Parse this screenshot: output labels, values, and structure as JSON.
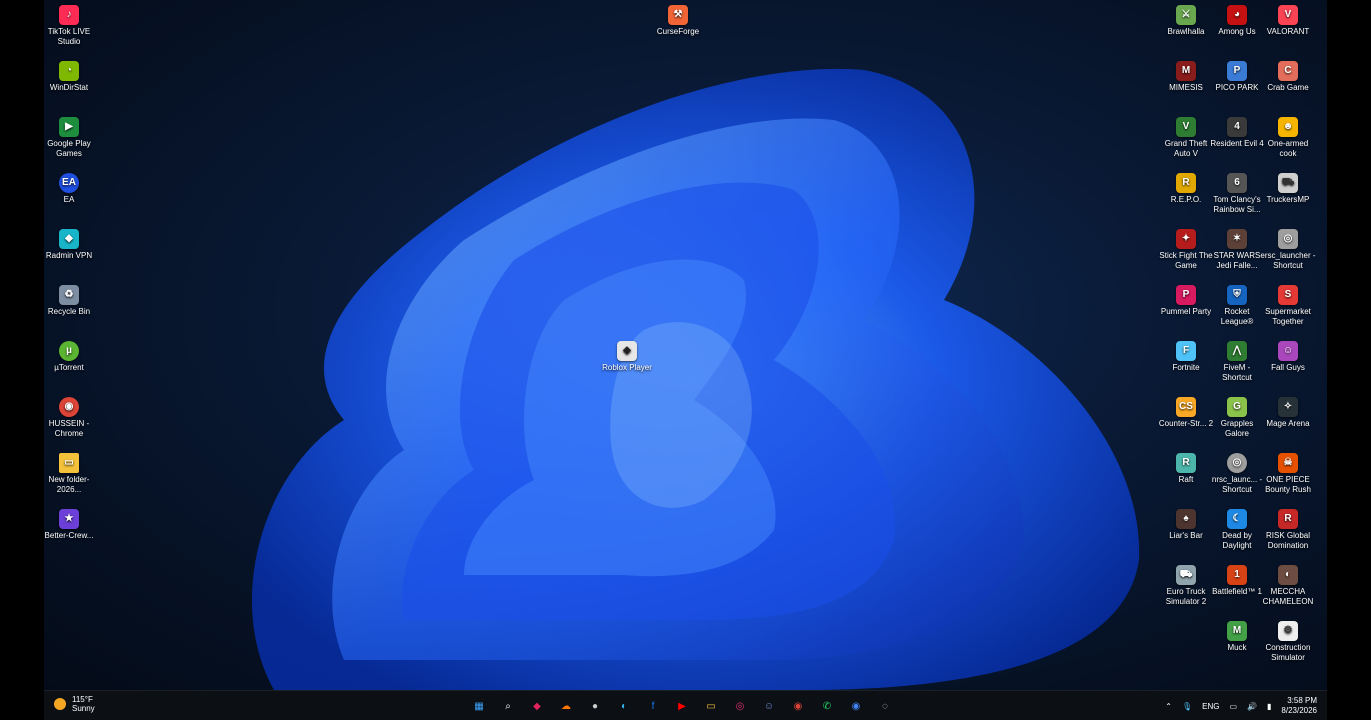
{
  "icons": {
    "tiktok": {
      "label": "TikTok LIVE Studio",
      "color": "#fe2c55",
      "icon": "tiktok-icon"
    },
    "windirstat": {
      "label": "WinDirStat",
      "color": "#7fb800",
      "icon": "windirstat-icon"
    },
    "googleplay": {
      "label": "Google Play Games",
      "color": "#1e8e3e",
      "icon": "google-play-icon"
    },
    "ea": {
      "label": "EA",
      "color": "#1f4fe0",
      "icon": "ea-icon"
    },
    "radmin": {
      "label": "Radmin VPN",
      "color": "#18b5c9",
      "icon": "radmin-icon"
    },
    "recycle": {
      "label": "Recycle Bin",
      "color": "#7d8ea3",
      "icon": "recycle-bin-icon"
    },
    "utorrent": {
      "label": "µTorrent",
      "color": "#5cb532",
      "icon": "utorrent-icon"
    },
    "hussein": {
      "label": "HUSSEIN - Chrome",
      "color": "#db4437",
      "icon": "chrome-icon"
    },
    "newfolder": {
      "label": "New folder-2026...",
      "color": "#f3c13a",
      "icon": "folder-icon"
    },
    "bettercrew": {
      "label": "Better-Crew...",
      "color": "#6b3fd8",
      "icon": "better-crew-icon"
    },
    "curseforge": {
      "label": "CurseForge",
      "color": "#f16436",
      "icon": "curseforge-icon"
    },
    "roblox": {
      "label": "Roblox Player",
      "color": "#e6e6e6",
      "icon": "roblox-icon"
    },
    "r1": [
      {
        "label": "Brawlhalla",
        "color": "#6aa84f",
        "icon": "brawlhalla-icon"
      },
      {
        "label": "Among Us",
        "color": "#c51111",
        "icon": "among-us-icon"
      },
      {
        "label": "VALORANT",
        "color": "#fa4454",
        "icon": "valorant-icon"
      }
    ],
    "r2": [
      {
        "label": "MIMESIS",
        "color": "#8a1c1c",
        "icon": "mimesis-icon"
      },
      {
        "label": "PICO PARK",
        "color": "#3a7bd5",
        "icon": "pico-park-icon"
      },
      {
        "label": "Crab Game",
        "color": "#e26d5a",
        "icon": "crab-game-icon"
      }
    ],
    "r3": [
      {
        "label": "Grand Theft Auto V",
        "color": "#2e7d32",
        "icon": "gta-icon"
      },
      {
        "label": "Resident Evil 4",
        "color": "#3a3a3a",
        "icon": "resident-evil-icon"
      },
      {
        "label": "One-armed cook",
        "color": "#f4b400",
        "icon": "cook-icon"
      }
    ],
    "r4": [
      {
        "label": "R.E.P.O.",
        "color": "#e0a800",
        "icon": "repo-icon"
      },
      {
        "label": "Tom Clancy's Rainbow Si...",
        "color": "#555555",
        "icon": "rainbow-six-icon"
      },
      {
        "label": "TruckersMP",
        "color": "#cfcfcf",
        "icon": "truckersmp-icon"
      }
    ],
    "r5": [
      {
        "label": "Stick Fight The Game",
        "color": "#b71c1c",
        "icon": "stick-fight-icon"
      },
      {
        "label": "STAR WARS Jedi Falle...",
        "color": "#5d4037",
        "icon": "star-wars-icon"
      },
      {
        "label": "ersc_launcher - Shortcut",
        "color": "#9e9e9e",
        "icon": "ersc-launcher-icon"
      }
    ],
    "r6": [
      {
        "label": "Pummel Party",
        "color": "#d81b60",
        "icon": "pummel-party-icon"
      },
      {
        "label": "Rocket League®",
        "color": "#1565c0",
        "icon": "rocket-league-icon"
      },
      {
        "label": "Supermarket Together",
        "color": "#e53935",
        "icon": "supermarket-icon"
      }
    ],
    "r7": [
      {
        "label": "Fortnite",
        "color": "#4fc3f7",
        "icon": "fortnite-icon"
      },
      {
        "label": "FiveM - Shortcut",
        "color": "#2e7d32",
        "icon": "fivem-icon"
      },
      {
        "label": "Fall Guys",
        "color": "#ab47bc",
        "icon": "fall-guys-icon"
      }
    ],
    "r8": [
      {
        "label": "Counter-Str... 2",
        "color": "#f9a825",
        "icon": "counter-strike-icon"
      },
      {
        "label": "Grapples Galore",
        "color": "#8bc34a",
        "icon": "grapples-icon"
      },
      {
        "label": "Mage Arena",
        "color": "#263238",
        "icon": "mage-arena-icon"
      }
    ],
    "r9": [
      {
        "label": "Raft",
        "color": "#4db6ac",
        "icon": "raft-icon"
      },
      {
        "label": "nrsc_launc... - Shortcut",
        "color": "#9e9e9e",
        "icon": "nrsc-launcher-icon"
      },
      {
        "label": "ONE PIECE Bounty Rush",
        "color": "#e65100",
        "icon": "one-piece-icon"
      }
    ],
    "r10": [
      {
        "label": "Liar's Bar",
        "color": "#4e342e",
        "icon": "liars-bar-icon"
      },
      {
        "label": "Dead by Daylight",
        "color": "#1e88e5",
        "icon": "dead-by-daylight-icon"
      },
      {
        "label": "RISK Global Domination",
        "color": "#c62828",
        "icon": "risk-icon"
      }
    ],
    "r11": [
      {
        "label": "Euro Truck Simulator 2",
        "color": "#90a4ae",
        "icon": "euro-truck-icon"
      },
      {
        "label": "Battlefield™ 1",
        "color": "#d84315",
        "icon": "battlefield-icon"
      },
      {
        "label": "MECCHA CHAMELEON",
        "color": "#6d4c41",
        "icon": "chameleon-icon"
      }
    ],
    "r12": [
      {
        "label": "Muck",
        "color": "#43a047",
        "icon": "muck-icon"
      },
      {
        "label": "Construction Simulator",
        "color": "#eeeeee",
        "icon": "construction-icon"
      }
    ]
  },
  "taskbar": {
    "weather_temp": "115°F",
    "weather_desc": "Sunny",
    "apps": [
      {
        "name": "start-icon",
        "glyph": "▦",
        "color": "#3ea6ff"
      },
      {
        "name": "search-icon",
        "glyph": "⌕",
        "color": "#ffffff"
      },
      {
        "name": "roblox-taskbar-icon",
        "glyph": "◆",
        "color": "#e0245e"
      },
      {
        "name": "soundcloud-icon",
        "glyph": "☁",
        "color": "#ff7700"
      },
      {
        "name": "github-icon",
        "glyph": "●",
        "color": "#cccccc"
      },
      {
        "name": "edge-icon",
        "glyph": "◐",
        "color": "#2fb2e8"
      },
      {
        "name": "facebook-icon",
        "glyph": "f",
        "color": "#1877f2"
      },
      {
        "name": "youtube-icon",
        "glyph": "▶",
        "color": "#ff0000"
      },
      {
        "name": "file-explorer-icon",
        "glyph": "▭",
        "color": "#f3c13a"
      },
      {
        "name": "instagram-icon",
        "glyph": "◎",
        "color": "#e1306c"
      },
      {
        "name": "discord-icon",
        "glyph": "☺",
        "color": "#7289da"
      },
      {
        "name": "chrome-taskbar-icon",
        "glyph": "◉",
        "color": "#db4437"
      },
      {
        "name": "whatsapp-icon",
        "glyph": "✆",
        "color": "#25d366"
      },
      {
        "name": "chrome-profile-icon",
        "glyph": "◉",
        "color": "#4285f4"
      },
      {
        "name": "obs-icon",
        "glyph": "◌",
        "color": "#dddddd"
      }
    ],
    "lang": "ENG",
    "time": "3:58 PM",
    "date": "8/23/2026"
  }
}
